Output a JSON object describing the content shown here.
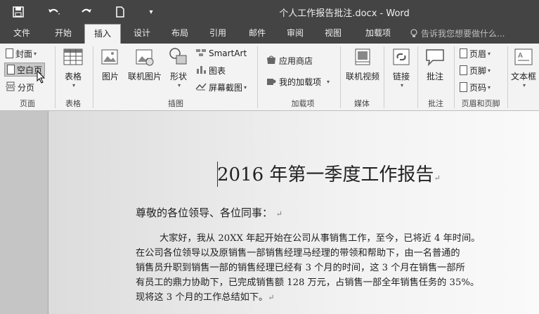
{
  "window": {
    "title": "个人工作报告批注.docx - Word"
  },
  "quick_access": {
    "save_icon": "save-icon",
    "undo_icon": "undo-icon",
    "redo_icon": "redo-icon",
    "new_icon": "new-document-icon",
    "customize_icon": "customize-toolbar-icon"
  },
  "tabs": [
    "文件",
    "开始",
    "插入",
    "设计",
    "布局",
    "引用",
    "邮件",
    "审阅",
    "视图",
    "加载项"
  ],
  "active_tab": "插入",
  "tell_me": {
    "placeholder": "告诉我您想要做什么..."
  },
  "ribbon": {
    "pages": {
      "cover": "封面",
      "blank": "空白页",
      "break": "分页",
      "label": "页面"
    },
    "tables": {
      "table": "表格",
      "label": "表格"
    },
    "illustrations": {
      "picture": "图片",
      "online_picture": "联机图片",
      "shapes": "形状",
      "smartart": "SmartArt",
      "chart": "图表",
      "screenshot": "屏幕截图",
      "label": "插图"
    },
    "addins": {
      "store": "应用商店",
      "my_addins": "我的加载项",
      "label": "加载项"
    },
    "media": {
      "online_video": "联机视频",
      "label": "媒体"
    },
    "links": {
      "link": "链接"
    },
    "comments": {
      "comment": "批注",
      "label": "批注"
    },
    "header_footer": {
      "header": "页眉",
      "footer": "页脚",
      "page_number": "页码",
      "label": "页眉和页脚"
    },
    "text": {
      "textbox": "文本框"
    }
  },
  "document": {
    "heading": "2016 年第一季度工作报告",
    "greeting": "尊敬的各位领导、各位同事：",
    "paragraph_lines": [
      "大家好，我从 20XX 年起开始在公司从事销售工作，至今，已将近 4 年时间。",
      "在公司各位领导以及原销售一部销售经理马经理的带领和帮助下，由一名普通的",
      "销售员升职到销售一部的销售经理已经有 3 个月的时间，这 3 个月在销售一部所",
      "有员工的鼎力协助下，已完成销售额 128 万元，占销售一部全年销售任务的 35%。",
      "现将这 3 个月的工作总结如下。"
    ],
    "paragraph_mark": "↵"
  }
}
